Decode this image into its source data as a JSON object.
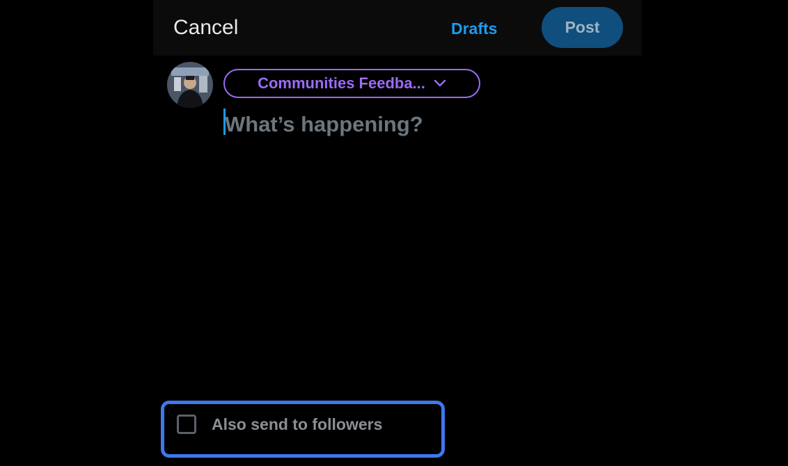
{
  "header": {
    "cancel_label": "Cancel",
    "drafts_label": "Drafts",
    "post_label": "Post"
  },
  "composer": {
    "audience_label": "Communities Feedba...",
    "placeholder": "What’s happening?",
    "value": ""
  },
  "options": {
    "also_send_label": "Also send to followers",
    "also_send_checked": false
  },
  "colors": {
    "accent": "#1d9bf0",
    "post_button_bg": "#0f4e7d",
    "audience_purple": "#9b6cf5",
    "highlight_box": "#3e78f0",
    "background": "#000000"
  },
  "icons": {
    "audience_dropdown": "chevron-down-icon",
    "checkbox": "checkbox-unchecked-icon"
  }
}
